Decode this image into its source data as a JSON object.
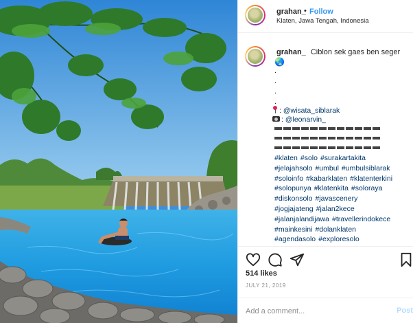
{
  "post": {
    "username": "grahan_",
    "separator": "•",
    "follow_label": "Follow",
    "location": "Klaten, Jawa Tengah, Indonesia"
  },
  "caption": {
    "username": "grahan_",
    "text": "Ciblon sek gaes ben seger",
    "emoji": "🌏",
    "dots": [
      ".",
      ".",
      ".",
      "."
    ],
    "credit_1_prefix": ": ",
    "credit_1_handle": "@wisata_siblarak",
    "credit_2_prefix": ": ",
    "credit_2_handle": "@leonarvin_",
    "hashtags": [
      "#klaten",
      "#solo",
      "#surakartakita",
      "#jelajahsolo",
      "#umbul",
      "#umbulsiblarak",
      "#soloinfo",
      "#kabarklaten",
      "#klatenterkini",
      "#solopunya",
      "#klatenkita",
      "#soloraya",
      "#diskonsolo",
      "#javascenery",
      "#jogjajateng",
      "#jalan2kece",
      "#jalanjalandijawa",
      "#travellerindokece",
      "#mainkesini",
      "#dolanklaten",
      "#agendasolo",
      "#exploresolo"
    ],
    "hashtag_lines": [
      3,
      3,
      3,
      3,
      2,
      2,
      2,
      2,
      2
    ]
  },
  "actions": {
    "like_icon": "heart-icon",
    "comment_icon": "comment-icon",
    "share_icon": "share-icon",
    "save_icon": "bookmark-icon",
    "likes_text": "514 likes",
    "date_text": "JULY 21, 2019"
  },
  "comment": {
    "placeholder": "Add a comment...",
    "post_label": "Post"
  },
  "colors": {
    "link": "#3897f0",
    "hashtag": "#00376b",
    "post_disabled": "#b3dbff",
    "muted": "#8e8e8e"
  }
}
